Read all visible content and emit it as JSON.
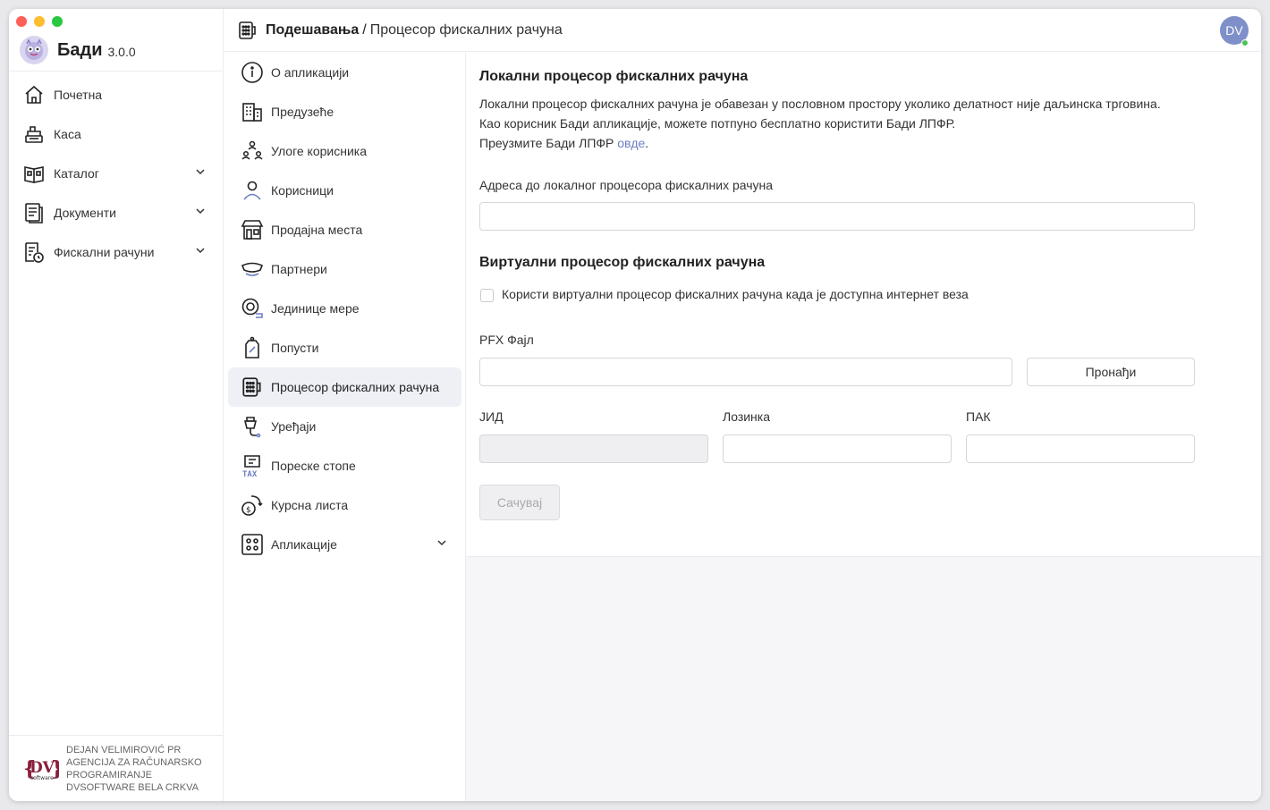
{
  "app": {
    "name": "Бади",
    "version": "3.0.0"
  },
  "sidebar": {
    "items": [
      {
        "label": "Почетна",
        "icon": "home-icon"
      },
      {
        "label": "Каса",
        "icon": "cash-register-icon"
      },
      {
        "label": "Каталог",
        "icon": "catalog-icon",
        "expandable": true
      },
      {
        "label": "Документи",
        "icon": "documents-icon",
        "expandable": true
      },
      {
        "label": "Фискални рачуни",
        "icon": "fiscal-receipts-icon",
        "expandable": true
      }
    ],
    "footer": {
      "line1": "DEJAN VELIMIROVIĆ PR",
      "line2": "AGENCIJA ZA RAČUNARSKO",
      "line3": "PROGRAMIRANJE",
      "line4": "DVSOFTWARE BELA CRKVA",
      "logo_text": "DV",
      "logo_sub": "software"
    }
  },
  "header": {
    "section": "Подешавања",
    "separator": "/",
    "page": "Процесор фискалних рачуна",
    "avatar": "DV"
  },
  "settings_menu": {
    "items": [
      {
        "label": "О апликацији",
        "icon": "info-icon"
      },
      {
        "label": "Предузеће",
        "icon": "building-icon"
      },
      {
        "label": "Улоге корисника",
        "icon": "user-roles-icon"
      },
      {
        "label": "Корисници",
        "icon": "user-icon"
      },
      {
        "label": "Продајна места",
        "icon": "store-icon"
      },
      {
        "label": "Партнери",
        "icon": "partners-icon"
      },
      {
        "label": "Јединице мере",
        "icon": "units-icon"
      },
      {
        "label": "Попусти",
        "icon": "discount-tag-icon"
      },
      {
        "label": "Процесор фискалних рачуна",
        "icon": "fiscal-processor-icon",
        "active": true
      },
      {
        "label": "Уређаји",
        "icon": "devices-icon"
      },
      {
        "label": "Пореске стопе",
        "icon": "tax-icon"
      },
      {
        "label": "Курсна листа",
        "icon": "exchange-rate-icon"
      },
      {
        "label": "Апликације",
        "icon": "apps-icon",
        "expandable": true
      }
    ]
  },
  "local": {
    "title": "Локални процесор фискалних рачуна",
    "desc1": "Локални процесор фискалних рачуна је обавезан у пословном простору уколико делатност није даљинска трговина.",
    "desc2": "Као корисник Бади апликације, можете потпуно бесплатно користити Бади ЛПФР.",
    "desc3_prefix": "Преузмите Бади ЛПФР ",
    "desc3_link": "овде",
    "desc3_suffix": ".",
    "address_label": "Адреса до локалног процесора фискалних рачуна",
    "address_value": ""
  },
  "virtual": {
    "title": "Виртуални процесор фискалних рачуна",
    "checkbox_label": "Користи виртуални процесор фискалних рачуна када је доступна интернет веза",
    "checkbox_checked": false,
    "pfx_label": "PFX Фајл",
    "pfx_value": "",
    "browse_label": "Пронађи",
    "jid_label": "ЈИД",
    "jid_value": "",
    "password_label": "Лозинка",
    "password_value": "",
    "pak_label": "ПАК",
    "pak_value": "",
    "save_label": "Сачувај"
  },
  "colors": {
    "accent": "#6b7fc4",
    "avatar_bg": "#7e8fc9",
    "online": "#4cc35a",
    "active_bg": "#eef0f6"
  }
}
